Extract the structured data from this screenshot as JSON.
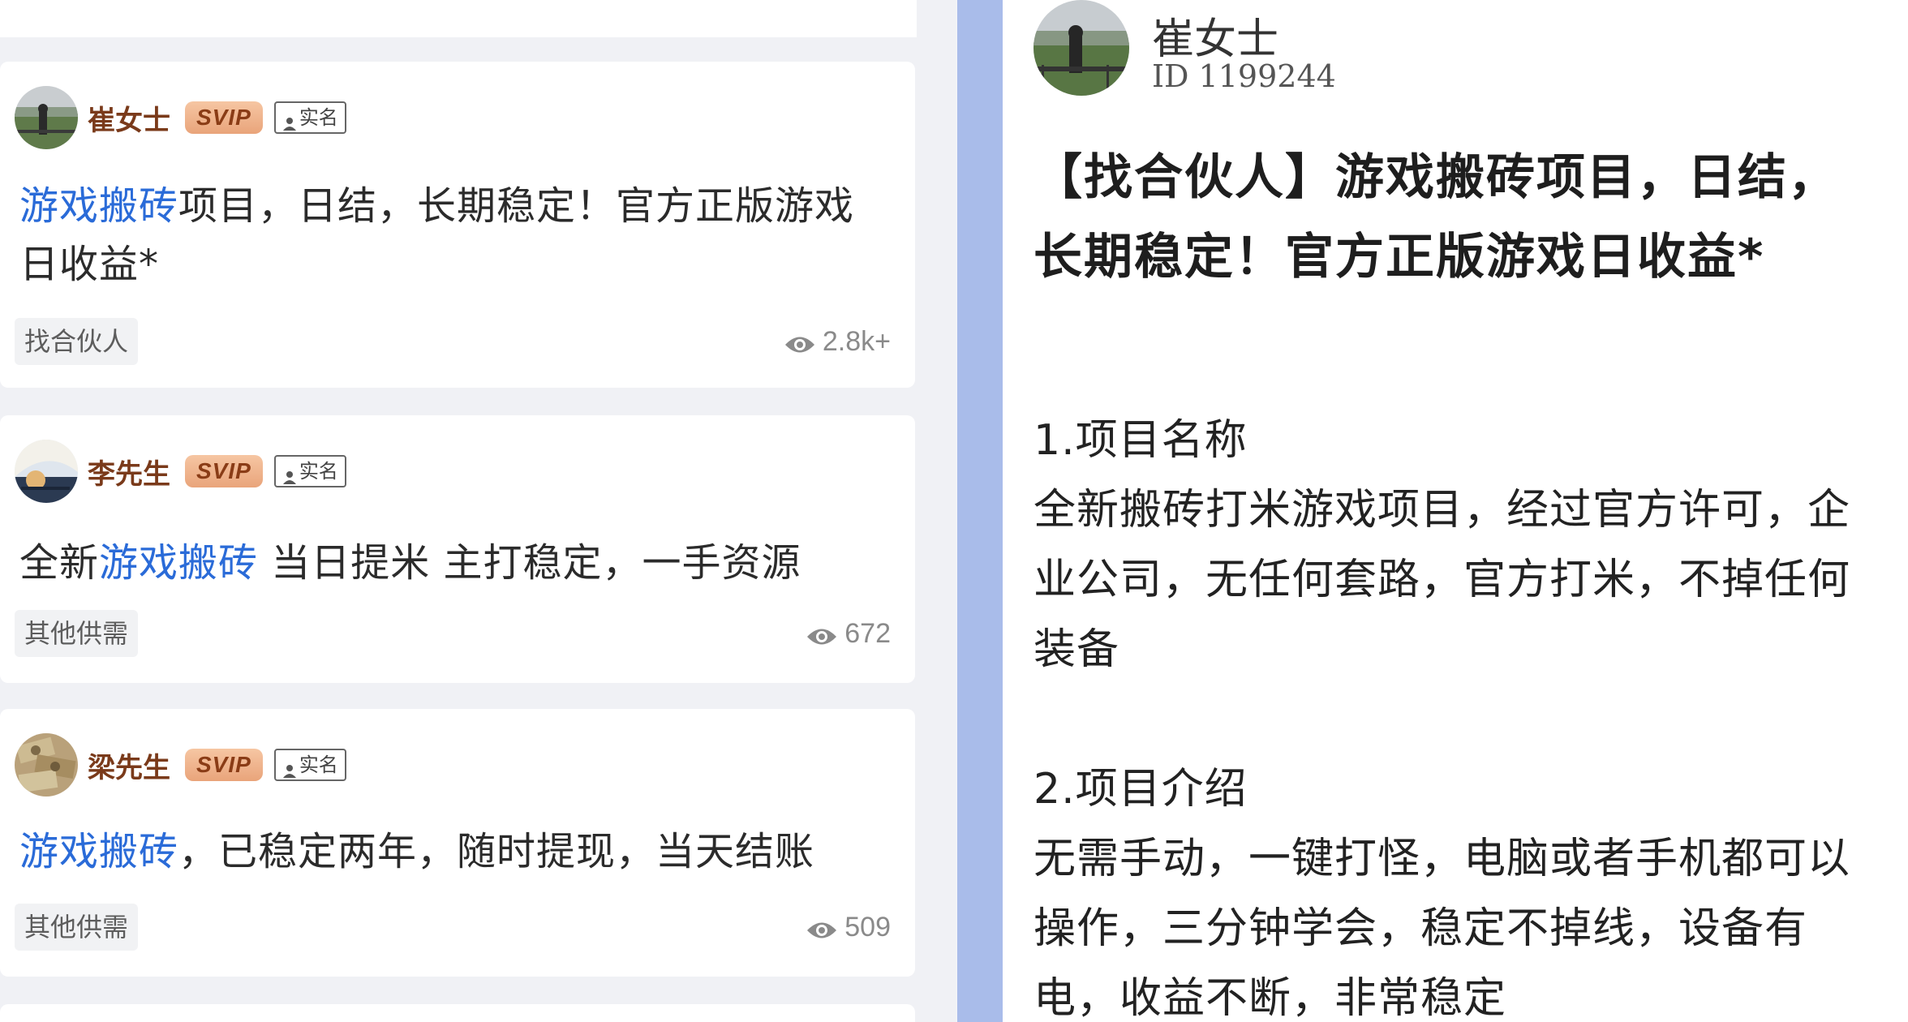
{
  "feed": {
    "posts": [
      {
        "author": "崔女士",
        "svip": "SVIP",
        "verified": "实名",
        "title_highlight": "游戏搬砖",
        "title_rest": "项目，日结，长期稳定！官方正版游戏日收益*",
        "tag": "找合伙人",
        "views": "2.8k+"
      },
      {
        "author": "李先生",
        "svip": "SVIP",
        "verified": "实名",
        "title_prefix": "全新",
        "title_highlight": "游戏搬砖",
        "title_rest": " 当日提米 主打稳定，一手资源",
        "tag": "其他供需",
        "views": "672"
      },
      {
        "author": "梁先生",
        "svip": "SVIP",
        "verified": "实名",
        "title_highlight": "游戏搬砖",
        "title_rest": "，已稳定两年，随时提现，当天结账",
        "tag": "其他供需",
        "views": "509"
      }
    ]
  },
  "detail": {
    "author": "崔女士",
    "user_id": "ID 1199244",
    "title": "【找合伙人】游戏搬砖项目，日结，长期稳定！官方正版游戏日收益*",
    "section1_heading": "1.项目名称",
    "section1_body": "全新搬砖打米游戏项目，经过官方许可，企业公司，无任何套路，官方打米，不掉任何装备",
    "section2_heading": "2.项目介绍",
    "section2_body": "无需手动，一键打怪，电脑或者手机都可以操作，三分钟学会，稳定不掉线，设备有电，收益不断，非常稳定"
  },
  "colors": {
    "keyword": "#2a6bd8",
    "author_name": "#7a3a1a",
    "divider": "#a9bcea"
  }
}
